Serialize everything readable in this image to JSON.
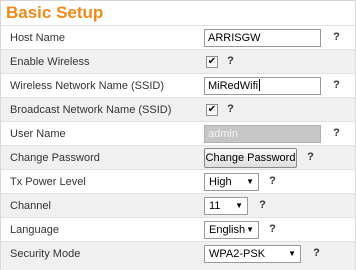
{
  "page": {
    "title": "Basic Setup"
  },
  "fields": {
    "host_name": {
      "label": "Host Name",
      "value": "ARRISGW",
      "help_icon": "question-mark"
    },
    "enable_wireless": {
      "label": "Enable Wireless",
      "checked": true,
      "check_glyph": "✔",
      "help_icon": "question-mark"
    },
    "ssid": {
      "label": "Wireless Network Name (SSID)",
      "value": "MiRedWifi",
      "help_icon": "question-mark"
    },
    "broadcast_ssid": {
      "label": "Broadcast Network Name (SSID)",
      "checked": true,
      "check_glyph": "✔",
      "help_icon": "question-mark"
    },
    "user_name": {
      "label": "User Name",
      "value": "admin",
      "help_icon": "question-mark"
    },
    "change_password": {
      "label": "Change Password",
      "button_label": "Change Password",
      "help_icon": "question-mark"
    },
    "tx_power": {
      "label": "Tx Power Level",
      "value": "High",
      "arrow": "▼",
      "help_icon": "question-mark"
    },
    "channel": {
      "label": "Channel",
      "value": "11",
      "arrow": "▼",
      "help_icon": "question-mark"
    },
    "language": {
      "label": "Language",
      "value": "English",
      "arrow": "▼",
      "help_icon": "question-mark"
    },
    "security_mode": {
      "label": "Security Mode",
      "value": "WPA2-PSK",
      "arrow": "▼",
      "help_icon": "question-mark"
    }
  },
  "help_glyph": "?",
  "colors": {
    "title": "#ef8a1a",
    "row_alt": "#f0f0f0",
    "disabled_input": "#c6c6c6"
  }
}
